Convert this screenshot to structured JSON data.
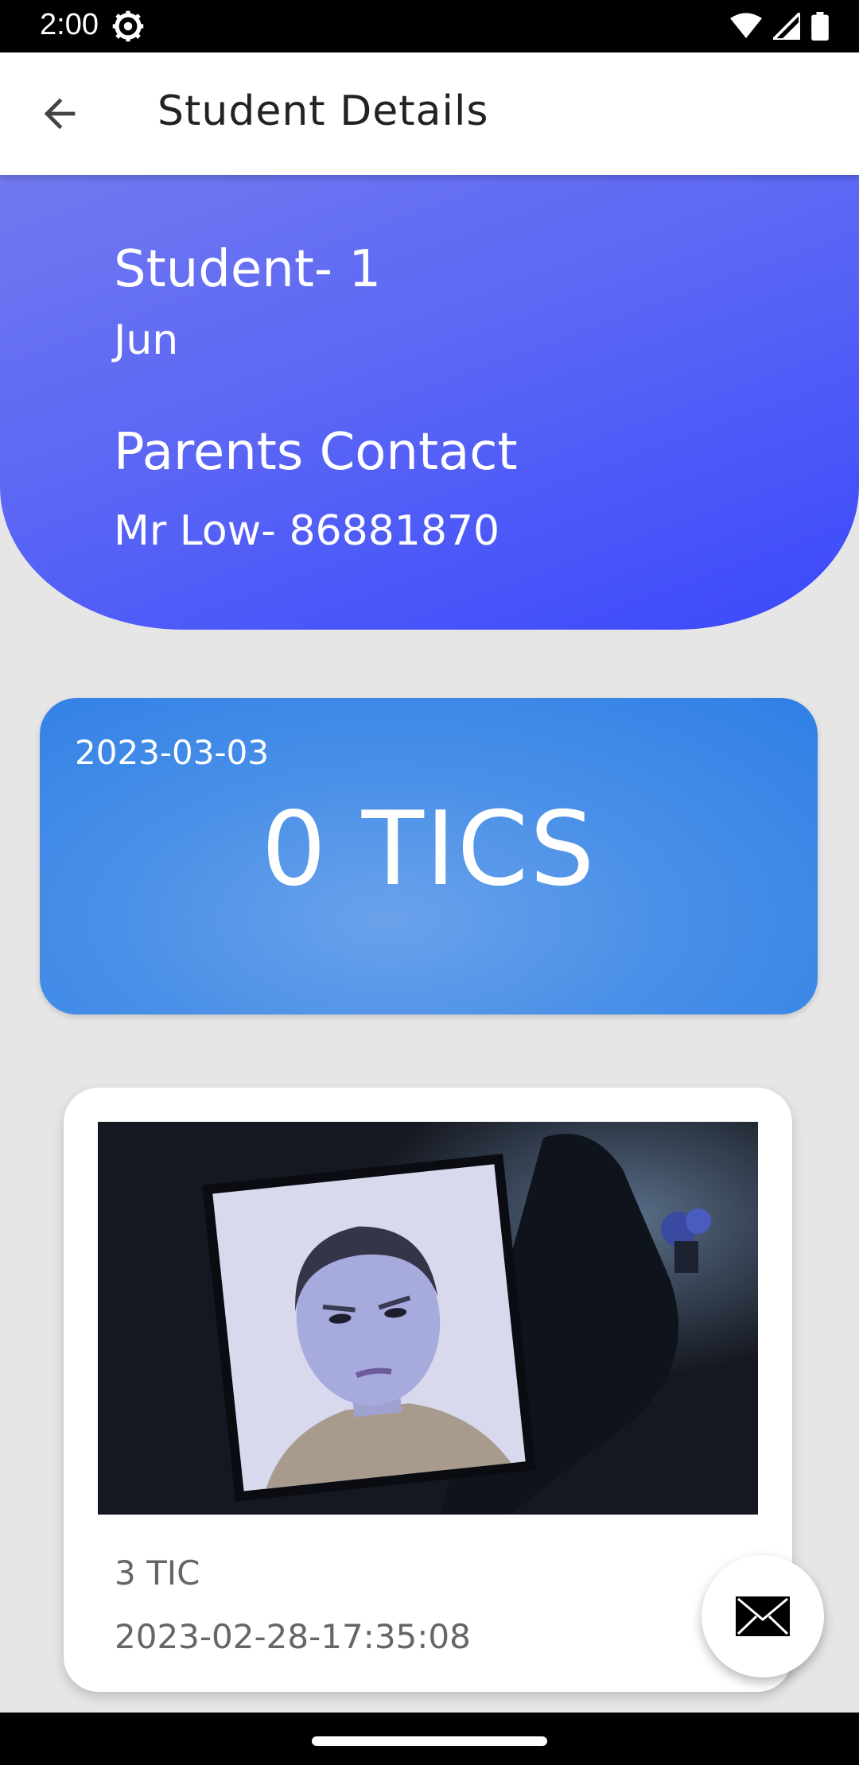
{
  "status_bar": {
    "time": "2:00",
    "icons": [
      "settings-icon",
      "wifi-icon",
      "signal-icon",
      "battery-icon"
    ]
  },
  "app_bar": {
    "title": "Student Details",
    "back_icon": "arrow-back-icon"
  },
  "student": {
    "name": "Student- 1",
    "sub_name": "Jun",
    "parents_label": "Parents Contact",
    "parents_value": "Mr Low-  86881870"
  },
  "tics_summary": {
    "date": "2023-03-03",
    "count_label": "0 TICS"
  },
  "record": {
    "tic_label": "3 TIC",
    "timestamp": "2023-02-28-17:35:08"
  },
  "fab": {
    "icon": "mail-icon"
  },
  "colors": {
    "header_gradient_start": "#7179ef",
    "header_gradient_end": "#3b49fb",
    "tics_card": "#4a90e8",
    "background": "#e6e6e6"
  }
}
